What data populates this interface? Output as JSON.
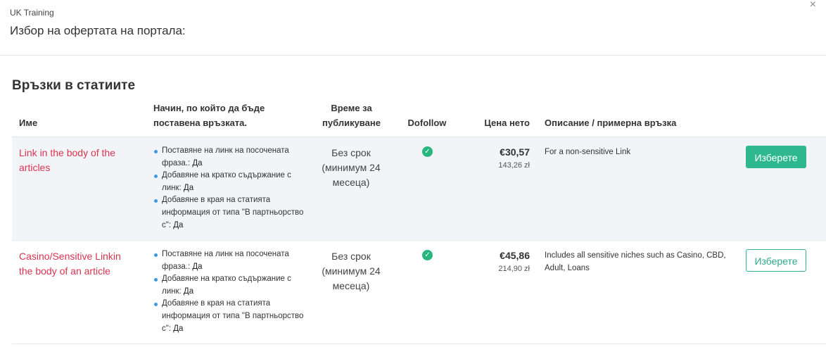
{
  "header": {
    "site_name": "UK Training",
    "title": "Избор на офертата на портала:",
    "close_icon": "×"
  },
  "section": {
    "title": "Връзки в статиите"
  },
  "columns": {
    "name": "Име",
    "method": "Начин, по който да бъде поставена връзката.",
    "time": "Време за публикуване",
    "dofollow": "Dofollow",
    "price": "Цена нето",
    "description": "Описание / примерна връзка"
  },
  "rows": [
    {
      "name": "Link in the body of the articles",
      "methods": [
        {
          "label": "Поставяне на линк на посочената фраза.:",
          "value": "Да"
        },
        {
          "label": "Добавяне на кратко съдържание с линк:",
          "value": "Да"
        },
        {
          "label": "Добавяне в края на статията информация от типа \"В партньорство с\":",
          "value": "Да"
        }
      ],
      "time": "Без срок (минимум 24 месеца)",
      "dofollow_icon": "check-circle-icon",
      "price_eur": "€30,57",
      "price_pln": "143,26 zł",
      "description": "For a non-sensitive Link",
      "button": "Изберете"
    },
    {
      "name": "Casino/Sensitive Linkin the body of an article",
      "methods": [
        {
          "label": "Поставяне на линк на посочената фраза.:",
          "value": "Да"
        },
        {
          "label": "Добавяне на кратко съдържание с линк:",
          "value": "Да"
        },
        {
          "label": "Добавяне в края на статията информация от типа \"В партньорство с\":",
          "value": "Да"
        }
      ],
      "time": "Без срок (минимум 24 месеца)",
      "dofollow_icon": "check-circle-icon",
      "price_eur": "€45,86",
      "price_pln": "214,90 zł",
      "description": "Includes all sensitive niches such as Casino, CBD, Adult, Loans",
      "button": "Изберете"
    }
  ],
  "colors": {
    "link": "#d9344f",
    "accent": "#2fb88f",
    "row_alt": "#f3f4f8"
  }
}
